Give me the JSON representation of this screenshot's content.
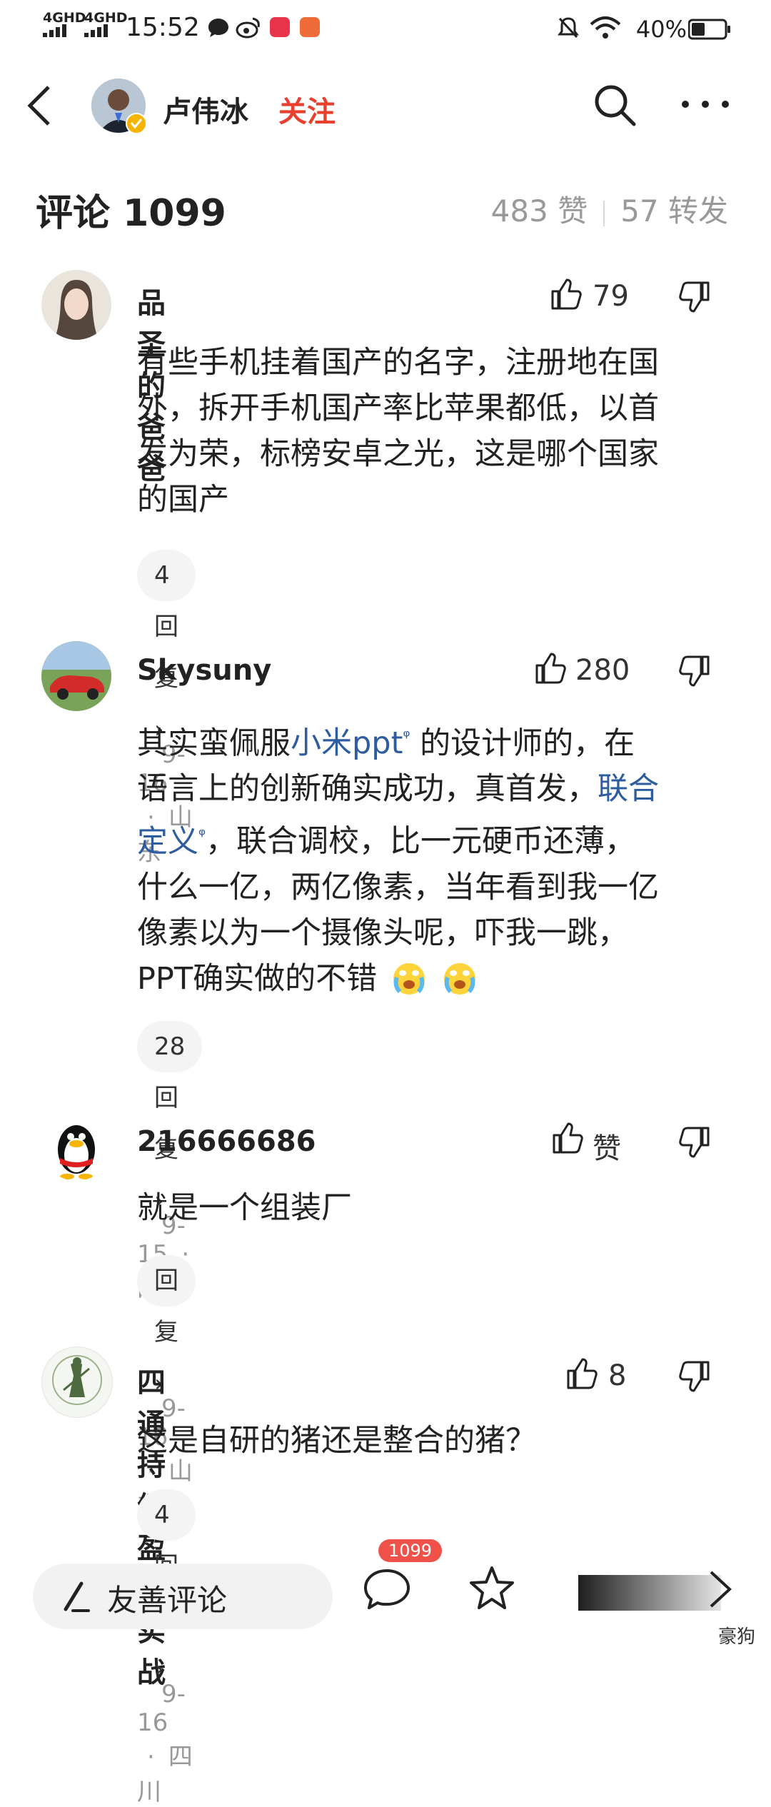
{
  "status_bar": {
    "signal1": "4GHD",
    "signal2": "4GHD",
    "time": "15:52",
    "battery": "40%"
  },
  "header": {
    "name": "卢伟冰",
    "follow_label": "关注"
  },
  "comment_bar": {
    "title": "评论 1099",
    "likes": "483 赞",
    "reposts": "57 转发"
  },
  "comments": [
    {
      "username": "品圣的爸爸",
      "likes": "79",
      "text": [
        "有些手机挂着国产的名字，注册地在国",
        "外，拆开手机国产率比苹果都低，以首",
        "发为荣，标榜安卓之光，这是哪个国家",
        "的国产"
      ],
      "reply": "4回复",
      "date": "9-16",
      "location": "山东"
    },
    {
      "username": "Skysuny",
      "likes": "280",
      "text_parts": {
        "l1a": "其实蛮佩服",
        "l1link": "小米ppt",
        "l1b": " 的设计师的，在",
        "l2a": "语言上的创新确实成功，真首发，",
        "l2link": "联合",
        "l3link": "定义",
        "l3b": "，联合调校，比一元硬币还薄，",
        "l4": "什么一亿，两亿像素，当年看到我一亿",
        "l5": "像素以为一个摄像头呢，吓我一跳，",
        "l6": "PPT确实做的不错"
      },
      "reply": "28回复",
      "date": "9-15",
      "location": "四川"
    },
    {
      "username": "216666686",
      "likes": "赞",
      "text": [
        "就是一个组装厂"
      ],
      "reply": "回复",
      "date": "9-16",
      "location": "山东"
    },
    {
      "username": "四通持续盈利实战",
      "likes": "8",
      "text": [
        "这是自研的猪还是整合的猪？"
      ],
      "reply": "4回复",
      "date": "9-16",
      "location": "四川"
    }
  ],
  "bottom_bar": {
    "input_label": "友善评论",
    "comment_badge": "1099",
    "watermark": "豪狗"
  },
  "colors": {
    "follow": "#e8402e",
    "link": "#2d5c9f",
    "badge": "#f0524a",
    "meta": "#999999"
  },
  "icons": [
    "back-icon",
    "search-icon",
    "more-icon",
    "thumbs-up-icon",
    "thumbs-down-icon",
    "comment-icon",
    "star-icon",
    "share-icon",
    "crying-emoji-icon"
  ]
}
